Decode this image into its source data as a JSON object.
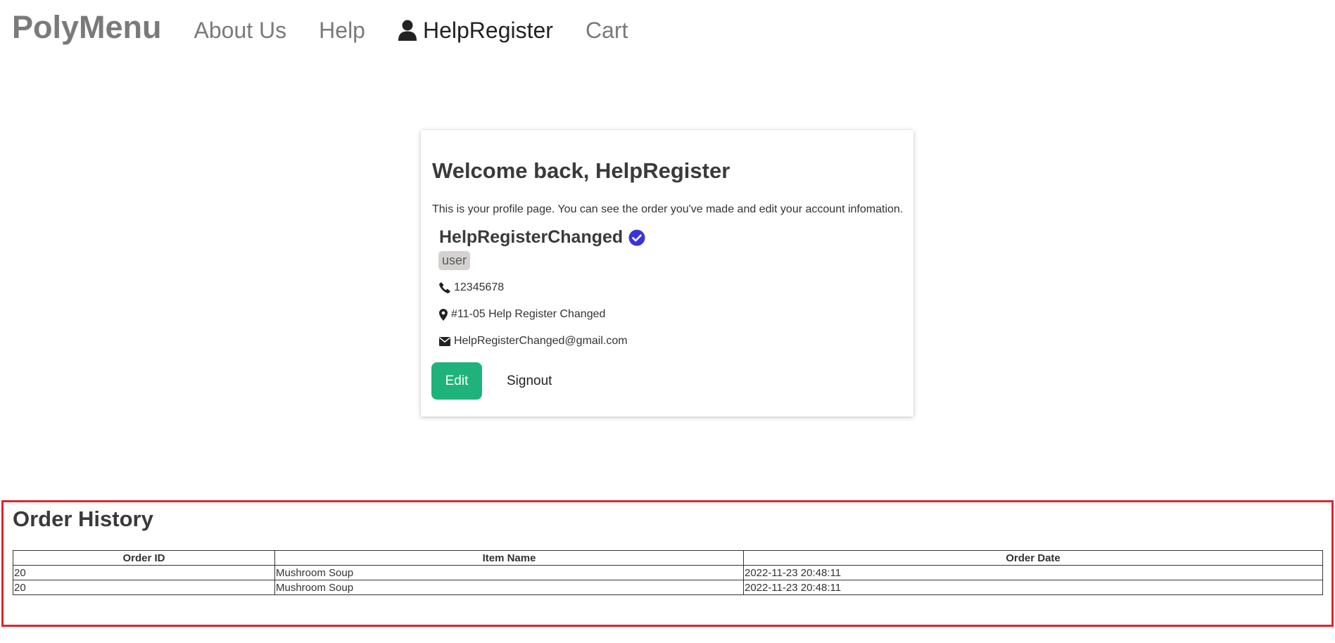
{
  "nav": {
    "brand": "PolyMenu",
    "about": "About Us",
    "help": "Help",
    "user": "HelpRegister",
    "cart": "Cart"
  },
  "profile": {
    "title": "Welcome back, HelpRegister",
    "intro": "This is your profile page. You can see the order you've made and edit your account infomation.",
    "username": "HelpRegisterChanged",
    "role": "user",
    "phone": "12345678",
    "address": "#11-05 Help Register Changed",
    "email": "HelpRegisterChanged@gmail.com",
    "edit_label": "Edit",
    "signout_label": "Signout"
  },
  "orders": {
    "title": "Order History",
    "headers": [
      "Order ID",
      "Item Name",
      "Order Date"
    ],
    "rows": [
      [
        "20",
        "Mushroom Soup",
        "2022-11-23 20:48:11"
      ],
      [
        "20",
        "Mushroom Soup",
        "2022-11-23 20:48:11"
      ]
    ]
  },
  "colors": {
    "accent": "#1fb37b",
    "verified": "#3a34d6",
    "highlight_border": "#d9262f"
  },
  "icons": {
    "user": "user-icon",
    "verified": "verified-check-icon",
    "phone": "phone-icon",
    "location": "map-pin-icon",
    "mail": "envelope-icon"
  }
}
